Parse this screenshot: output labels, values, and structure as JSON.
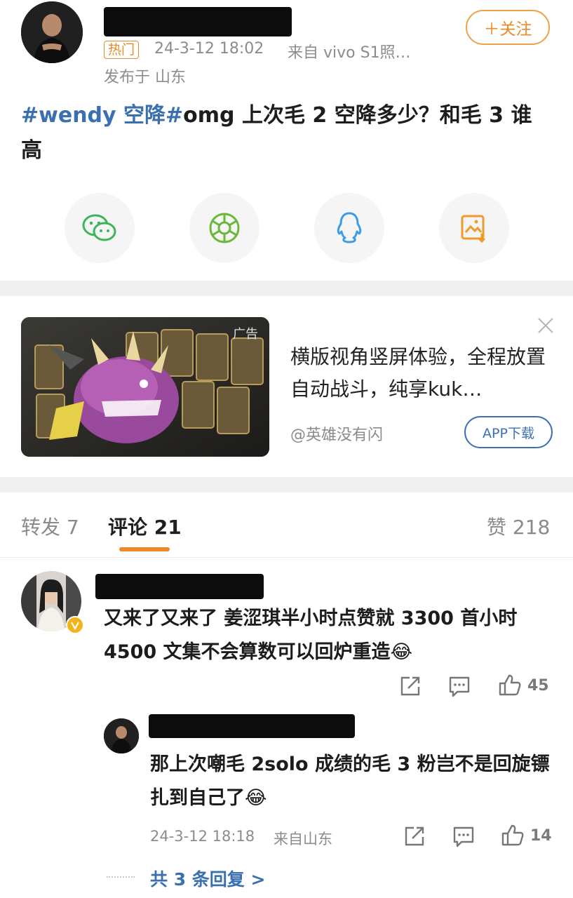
{
  "post": {
    "hot_tag": "热门",
    "timestamp": "24-3-12 18:02",
    "source": "来自 vivo S1照…",
    "location": "发布于 山东",
    "follow_label": "＋关注",
    "hashtag1": "#wendy 空降#",
    "body": "omg 上次毛 2 空降多少？和毛 3 谁高"
  },
  "share": {
    "items": [
      {
        "icon": "wechat-icon"
      },
      {
        "icon": "moments-icon"
      },
      {
        "icon": "qq-icon"
      },
      {
        "icon": "save-image-icon"
      }
    ]
  },
  "ad": {
    "badge": "广告",
    "text": "横版视角竖屏体验，全程放置自动战斗，纯享kuk…",
    "advertiser": "@英雄没有闪",
    "download_label": "APP下载",
    "close_icon": "close-icon"
  },
  "tabs": {
    "repost": "转发 7",
    "comments": "评论 21",
    "likes": "赞 218"
  },
  "comments": [
    {
      "text": "又来了又来了 姜涩琪半小时点赞就 3300 首小时 4500 文集不会算数可以回炉重造",
      "emoji": "😂",
      "like_count": "45",
      "reply": {
        "text": "那上次嘲毛 2solo 成绩的毛 3 粉岂不是回旋镖扎到自己了",
        "emoji": "😂",
        "timestamp": "24-3-12 18:18",
        "source": "来自山东",
        "like_count": "14"
      },
      "more_replies": "共 3 条回复 >"
    }
  ],
  "colors": {
    "link": "#3a6fb0",
    "accent": "#ec8a2a",
    "ad_border": "#3d6fb5"
  }
}
